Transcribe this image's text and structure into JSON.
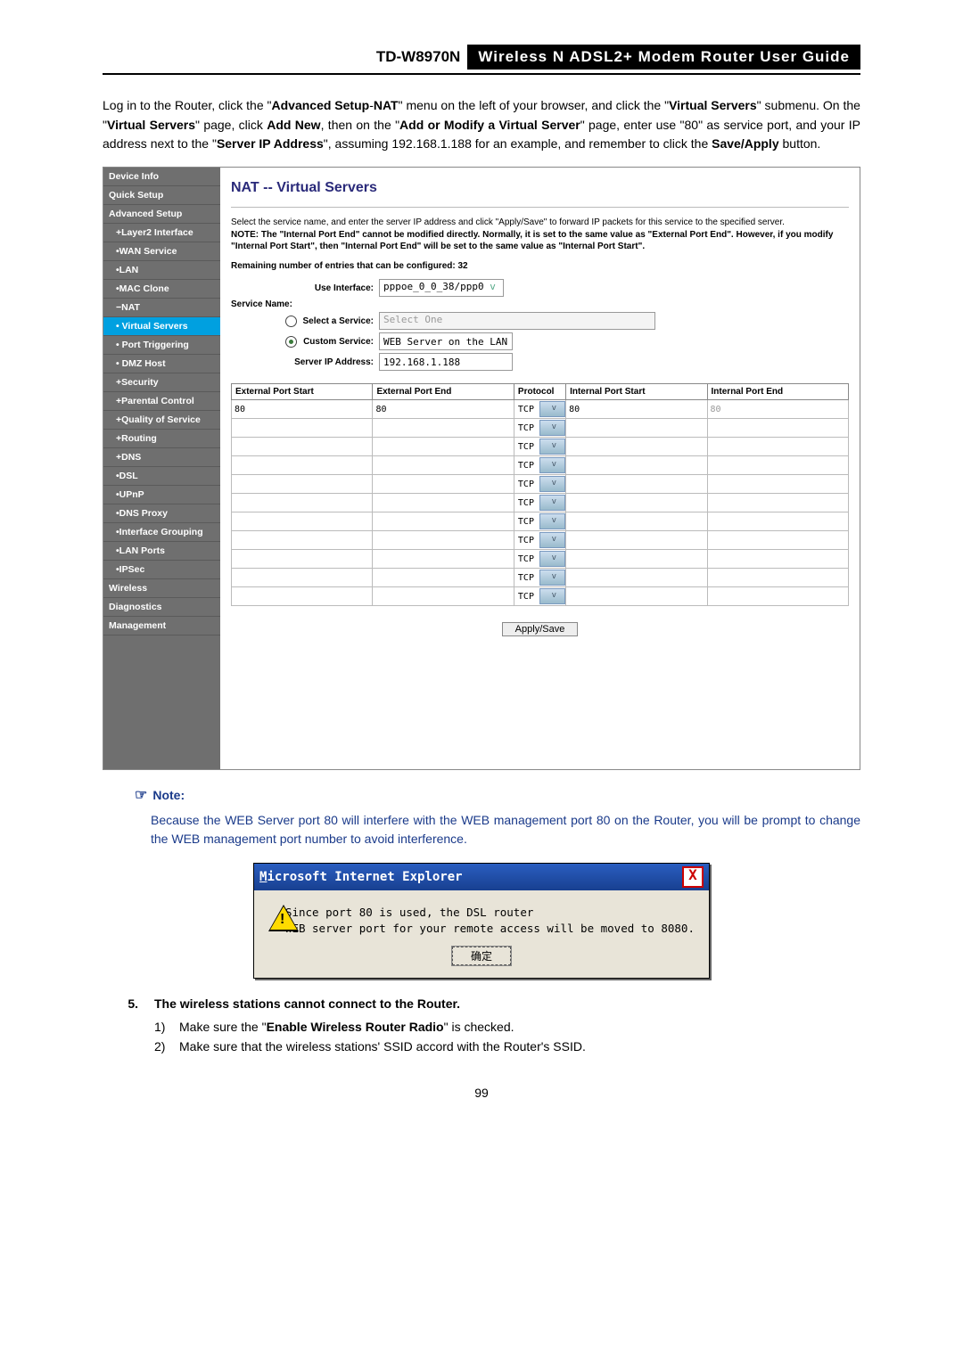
{
  "header": {
    "model": "TD-W8970N",
    "guide": "Wireless N ADSL2+ Modem Router User Guide"
  },
  "intro": {
    "t1a": "Log in to the Router, click the \"",
    "t1b": "Advanced Setup",
    "t1c": "-",
    "t1d": "NAT",
    "t1e": "\" menu on the left of your browser, and click the \"",
    "t1f": "Virtual Servers",
    "t1g": "\" submenu. On the \"",
    "t1h": "Virtual Servers",
    "t1i": "\" page, click ",
    "t1j": "Add New",
    "t1k": ", then on the \"",
    "t1l": "Add or Modify a Virtual Server",
    "t1m": "\" page, enter use \"80\" as service port, and your IP address next to the \"",
    "t1n": "Server IP Address",
    "t1o": "\", assuming 192.168.1.188 for an example, and remember to click the ",
    "t1p": "Save/Apply",
    "t1q": " button."
  },
  "sidebar": {
    "items": [
      "Device Info",
      "Quick Setup",
      "Advanced Setup",
      "+Layer2 Interface",
      "•WAN Service",
      "•LAN",
      "•MAC Clone",
      "−NAT",
      "• Virtual Servers",
      "• Port Triggering",
      "• DMZ Host",
      "+Security",
      "+Parental Control",
      "+Quality of Service",
      "+Routing",
      "+DNS",
      "•DSL",
      "•UPnP",
      "•DNS Proxy",
      "•Interface Grouping",
      "•LAN Ports",
      "•IPSec",
      "Wireless",
      "Diagnostics",
      "Management"
    ],
    "activeIndex": 8
  },
  "panel": {
    "title": "NAT -- Virtual Servers",
    "desc1": "Select the service name, and enter the server IP address and click \"Apply/Save\" to forward IP packets for this service to the specified server.",
    "desc2": "NOTE: The \"Internal Port End\" cannot be modified directly. Normally, it is set to the same value as \"External Port End\". However, if you modify \"Internal Port Start\", then \"Internal Port End\" will be set to the same value as \"Internal Port Start\".",
    "remaining": "Remaining number of entries that can be configured: 32",
    "labels": {
      "useInterface": "Use Interface:",
      "serviceName": "Service Name:",
      "selectService": "Select a Service:",
      "customService": "Custom Service:",
      "serverIp": "Server IP Address:"
    },
    "values": {
      "useInterface": "pppoe_0_0_38/ppp0",
      "selectService": "Select One",
      "customService": "WEB Server on the LAN",
      "serverIp": "192.168.1.188"
    },
    "tableHeaders": [
      "External Port Start",
      "External Port End",
      "Protocol",
      "Internal Port Start",
      "Internal Port End"
    ],
    "rows": [
      {
        "eps": "80",
        "epe": "80",
        "proto": "TCP",
        "ips": "80",
        "ipe": "80"
      },
      {
        "eps": "",
        "epe": "",
        "proto": "TCP",
        "ips": "",
        "ipe": ""
      },
      {
        "eps": "",
        "epe": "",
        "proto": "TCP",
        "ips": "",
        "ipe": ""
      },
      {
        "eps": "",
        "epe": "",
        "proto": "TCP",
        "ips": "",
        "ipe": ""
      },
      {
        "eps": "",
        "epe": "",
        "proto": "TCP",
        "ips": "",
        "ipe": ""
      },
      {
        "eps": "",
        "epe": "",
        "proto": "TCP",
        "ips": "",
        "ipe": ""
      },
      {
        "eps": "",
        "epe": "",
        "proto": "TCP",
        "ips": "",
        "ipe": ""
      },
      {
        "eps": "",
        "epe": "",
        "proto": "TCP",
        "ips": "",
        "ipe": ""
      },
      {
        "eps": "",
        "epe": "",
        "proto": "TCP",
        "ips": "",
        "ipe": ""
      },
      {
        "eps": "",
        "epe": "",
        "proto": "TCP",
        "ips": "",
        "ipe": ""
      },
      {
        "eps": "",
        "epe": "",
        "proto": "TCP",
        "ips": "",
        "ipe": ""
      }
    ],
    "applySave": "Apply/Save"
  },
  "note": {
    "heading": "Note:",
    "body": "Because the WEB Server port 80 will interfere with the WEB management port 80 on the Router, you will be prompt to change the WEB management port number to avoid interference."
  },
  "dialog": {
    "title": "Microsoft Internet Explorer",
    "msg": "Since port 80 is used, the DSL router\nWEB server port for your remote access will be moved to 8080.",
    "ok": "确定"
  },
  "section5": {
    "num": "5.",
    "title": "The wireless stations cannot connect to the Router.",
    "s1n": "1)",
    "s1a": "Make sure the \"",
    "s1b": "Enable Wireless Router Radio",
    "s1c": "\" is checked.",
    "s2n": "2)",
    "s2": "Make sure that the wireless stations' SSID accord with the Router's SSID."
  },
  "pageNum": "99"
}
